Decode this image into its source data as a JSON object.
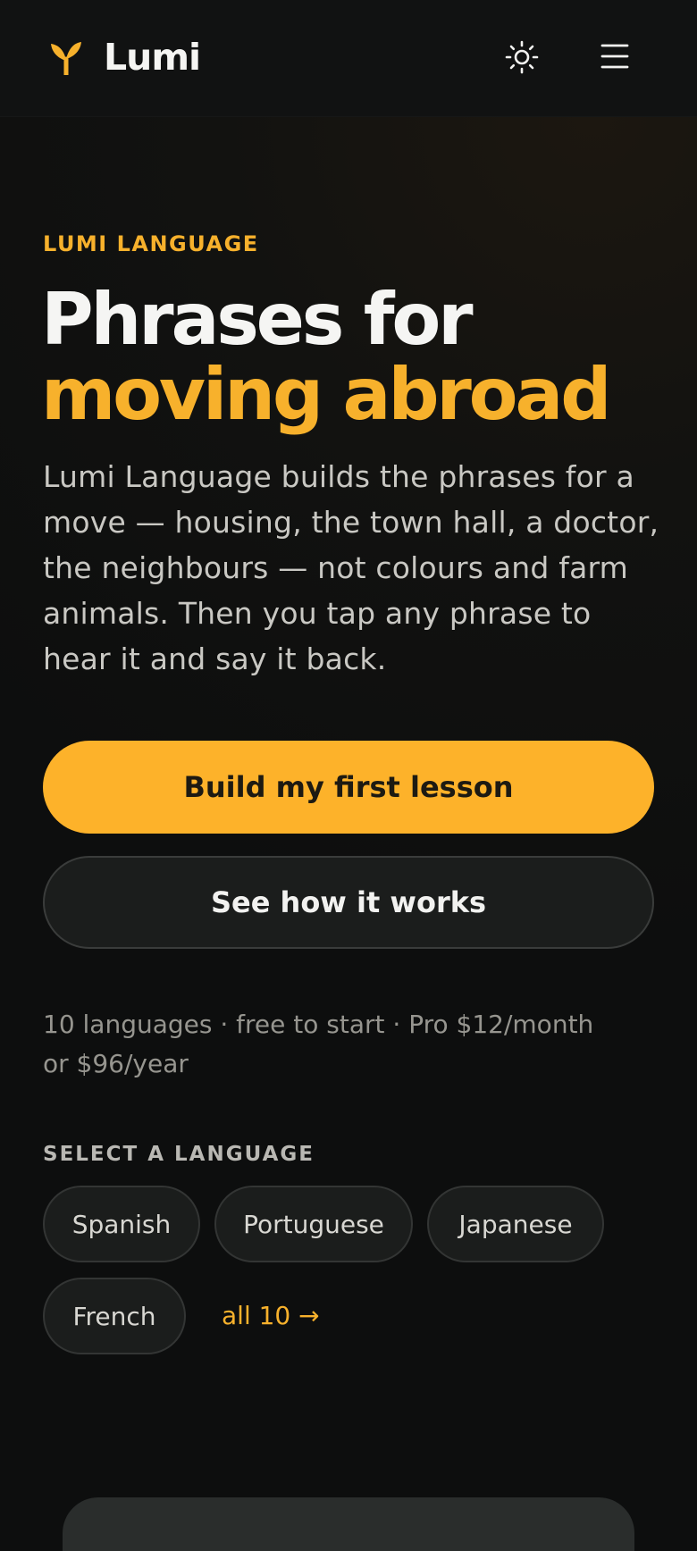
{
  "header": {
    "brand_name": "Lumi",
    "logo_icon": "sprout-icon",
    "theme_toggle_icon": "sun-icon",
    "menu_icon": "hamburger-menu-icon"
  },
  "hero": {
    "eyebrow": "LUMI LANGUAGE",
    "headline_line1": "Phrases for",
    "headline_line2": "moving abroad",
    "intro": "Lumi Language builds the phrases for a move — housing, the town hall, a doctor, the neighbours — not colours and farm animals. Then you tap any phrase to hear it and say it back."
  },
  "cta": {
    "primary_label": "Build my first lesson",
    "secondary_label": "See how it works"
  },
  "pricing": {
    "line1": "10 languages · free to start · Pro $12/month",
    "line2": "or $96/year"
  },
  "languages": {
    "label": "SELECT A LANGUAGE",
    "chips": [
      "Spanish",
      "Portuguese",
      "Japanese",
      "French"
    ],
    "all_link": "all 10 →"
  },
  "colors": {
    "accent": "#fdb22a",
    "background": "#0d0e0e",
    "surface": "#1b1d1c"
  }
}
